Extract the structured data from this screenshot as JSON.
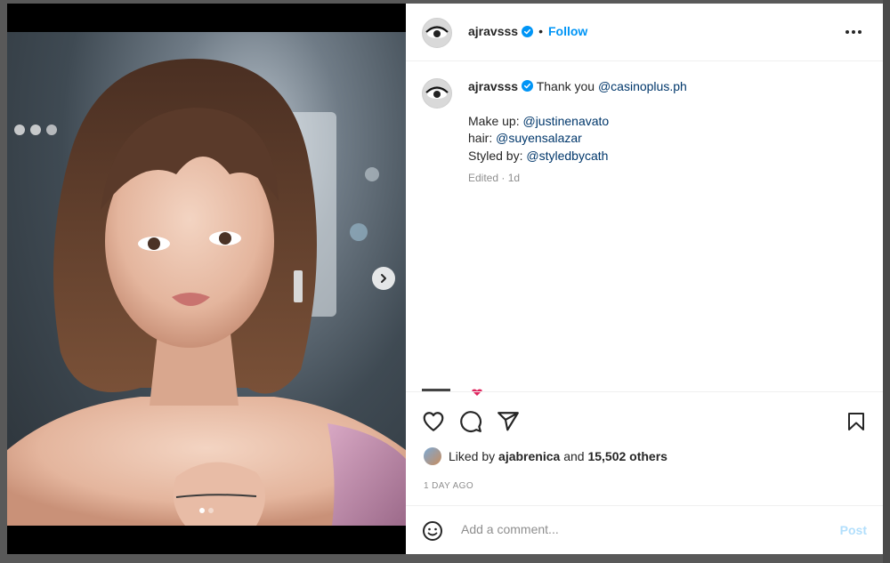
{
  "post": {
    "username": "ajravsss",
    "separator": "•",
    "follow_label": "Follow",
    "caption": {
      "intro": "Thank you",
      "sponsor": "@casinoplus.ph",
      "makeup_label": "Make up:",
      "makeup_handle": "@justinenavato",
      "hair_label": "hair:",
      "hair_handle": "@suyensalazar",
      "styled_label": "Styled by:",
      "styled_handle": "@styledbycath",
      "edited": "Edited · 1d"
    },
    "likes": {
      "prefix": "Liked by",
      "liker": "ajabrenica",
      "middle": "and",
      "others": "15,502 others"
    },
    "timestamp": "1 DAY AGO"
  },
  "comment": {
    "placeholder": "Add a comment...",
    "post_label": "Post"
  },
  "carousel": {
    "slide_count": 2,
    "current_slide": 1
  },
  "colors": {
    "accent": "#0095f6",
    "mention": "#00376b",
    "muted": "#8e8e8e"
  },
  "icons": [
    "verified-badge-icon",
    "more-options-icon",
    "next-arrow-icon",
    "heart-icon",
    "comment-icon",
    "share-icon",
    "bookmark-icon",
    "emoji-icon"
  ]
}
